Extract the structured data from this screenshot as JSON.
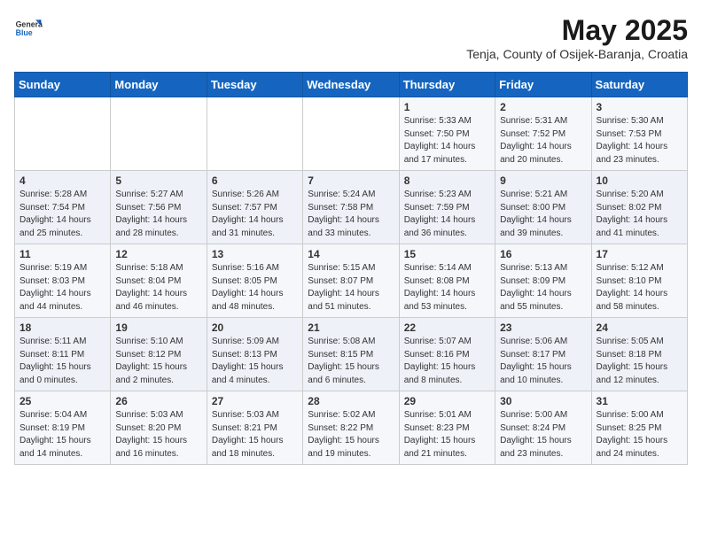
{
  "logo": {
    "general": "General",
    "blue": "Blue"
  },
  "title": "May 2025",
  "location": "Tenja, County of Osijek-Baranja, Croatia",
  "days": [
    "Sunday",
    "Monday",
    "Tuesday",
    "Wednesday",
    "Thursday",
    "Friday",
    "Saturday"
  ],
  "weeks": [
    [
      {
        "day": "",
        "content": ""
      },
      {
        "day": "",
        "content": ""
      },
      {
        "day": "",
        "content": ""
      },
      {
        "day": "",
        "content": ""
      },
      {
        "day": "1",
        "content": "Sunrise: 5:33 AM\nSunset: 7:50 PM\nDaylight: 14 hours\nand 17 minutes."
      },
      {
        "day": "2",
        "content": "Sunrise: 5:31 AM\nSunset: 7:52 PM\nDaylight: 14 hours\nand 20 minutes."
      },
      {
        "day": "3",
        "content": "Sunrise: 5:30 AM\nSunset: 7:53 PM\nDaylight: 14 hours\nand 23 minutes."
      }
    ],
    [
      {
        "day": "4",
        "content": "Sunrise: 5:28 AM\nSunset: 7:54 PM\nDaylight: 14 hours\nand 25 minutes."
      },
      {
        "day": "5",
        "content": "Sunrise: 5:27 AM\nSunset: 7:56 PM\nDaylight: 14 hours\nand 28 minutes."
      },
      {
        "day": "6",
        "content": "Sunrise: 5:26 AM\nSunset: 7:57 PM\nDaylight: 14 hours\nand 31 minutes."
      },
      {
        "day": "7",
        "content": "Sunrise: 5:24 AM\nSunset: 7:58 PM\nDaylight: 14 hours\nand 33 minutes."
      },
      {
        "day": "8",
        "content": "Sunrise: 5:23 AM\nSunset: 7:59 PM\nDaylight: 14 hours\nand 36 minutes."
      },
      {
        "day": "9",
        "content": "Sunrise: 5:21 AM\nSunset: 8:00 PM\nDaylight: 14 hours\nand 39 minutes."
      },
      {
        "day": "10",
        "content": "Sunrise: 5:20 AM\nSunset: 8:02 PM\nDaylight: 14 hours\nand 41 minutes."
      }
    ],
    [
      {
        "day": "11",
        "content": "Sunrise: 5:19 AM\nSunset: 8:03 PM\nDaylight: 14 hours\nand 44 minutes."
      },
      {
        "day": "12",
        "content": "Sunrise: 5:18 AM\nSunset: 8:04 PM\nDaylight: 14 hours\nand 46 minutes."
      },
      {
        "day": "13",
        "content": "Sunrise: 5:16 AM\nSunset: 8:05 PM\nDaylight: 14 hours\nand 48 minutes."
      },
      {
        "day": "14",
        "content": "Sunrise: 5:15 AM\nSunset: 8:07 PM\nDaylight: 14 hours\nand 51 minutes."
      },
      {
        "day": "15",
        "content": "Sunrise: 5:14 AM\nSunset: 8:08 PM\nDaylight: 14 hours\nand 53 minutes."
      },
      {
        "day": "16",
        "content": "Sunrise: 5:13 AM\nSunset: 8:09 PM\nDaylight: 14 hours\nand 55 minutes."
      },
      {
        "day": "17",
        "content": "Sunrise: 5:12 AM\nSunset: 8:10 PM\nDaylight: 14 hours\nand 58 minutes."
      }
    ],
    [
      {
        "day": "18",
        "content": "Sunrise: 5:11 AM\nSunset: 8:11 PM\nDaylight: 15 hours\nand 0 minutes."
      },
      {
        "day": "19",
        "content": "Sunrise: 5:10 AM\nSunset: 8:12 PM\nDaylight: 15 hours\nand 2 minutes."
      },
      {
        "day": "20",
        "content": "Sunrise: 5:09 AM\nSunset: 8:13 PM\nDaylight: 15 hours\nand 4 minutes."
      },
      {
        "day": "21",
        "content": "Sunrise: 5:08 AM\nSunset: 8:15 PM\nDaylight: 15 hours\nand 6 minutes."
      },
      {
        "day": "22",
        "content": "Sunrise: 5:07 AM\nSunset: 8:16 PM\nDaylight: 15 hours\nand 8 minutes."
      },
      {
        "day": "23",
        "content": "Sunrise: 5:06 AM\nSunset: 8:17 PM\nDaylight: 15 hours\nand 10 minutes."
      },
      {
        "day": "24",
        "content": "Sunrise: 5:05 AM\nSunset: 8:18 PM\nDaylight: 15 hours\nand 12 minutes."
      }
    ],
    [
      {
        "day": "25",
        "content": "Sunrise: 5:04 AM\nSunset: 8:19 PM\nDaylight: 15 hours\nand 14 minutes."
      },
      {
        "day": "26",
        "content": "Sunrise: 5:03 AM\nSunset: 8:20 PM\nDaylight: 15 hours\nand 16 minutes."
      },
      {
        "day": "27",
        "content": "Sunrise: 5:03 AM\nSunset: 8:21 PM\nDaylight: 15 hours\nand 18 minutes."
      },
      {
        "day": "28",
        "content": "Sunrise: 5:02 AM\nSunset: 8:22 PM\nDaylight: 15 hours\nand 19 minutes."
      },
      {
        "day": "29",
        "content": "Sunrise: 5:01 AM\nSunset: 8:23 PM\nDaylight: 15 hours\nand 21 minutes."
      },
      {
        "day": "30",
        "content": "Sunrise: 5:00 AM\nSunset: 8:24 PM\nDaylight: 15 hours\nand 23 minutes."
      },
      {
        "day": "31",
        "content": "Sunrise: 5:00 AM\nSunset: 8:25 PM\nDaylight: 15 hours\nand 24 minutes."
      }
    ]
  ]
}
